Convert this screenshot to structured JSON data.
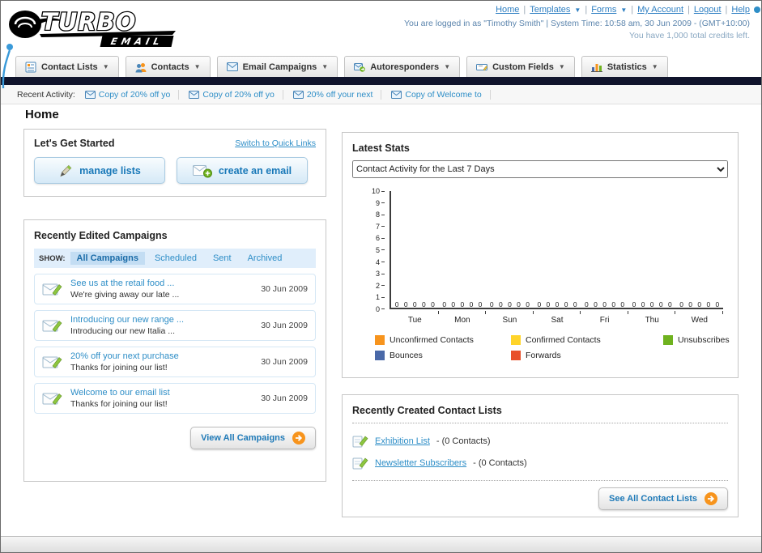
{
  "logo": {
    "brand": "TURBO",
    "sub": "EMAIL"
  },
  "header": {
    "links": [
      "Home",
      "Templates",
      "Forms",
      "My Account",
      "Logout",
      "Help"
    ],
    "login_text": "You are logged in as \"Timothy Smith\" | System Time: 10:58 am, 30 Jun 2009 - (GMT+10:00)",
    "credits_text": "You have 1,000 total credits left."
  },
  "nav": {
    "items": [
      {
        "label": "Contact Lists"
      },
      {
        "label": "Contacts"
      },
      {
        "label": "Email Campaigns"
      },
      {
        "label": "Autoresponders"
      },
      {
        "label": "Custom Fields"
      },
      {
        "label": "Statistics"
      }
    ]
  },
  "recent_activity": {
    "label": "Recent Activity:",
    "items": [
      {
        "label": "Copy of 20% off yo"
      },
      {
        "label": "Copy of 20% off yo"
      },
      {
        "label": "20% off your next"
      },
      {
        "label": "Copy of Welcome to"
      }
    ]
  },
  "page": {
    "title": "Home"
  },
  "get_started": {
    "title": "Let's Get Started",
    "switch_link": "Switch to Quick Links",
    "manage_button": "manage lists",
    "create_button": "create an email"
  },
  "campaigns": {
    "title": "Recently Edited Campaigns",
    "show_label": "SHOW:",
    "tabs": [
      {
        "label": "All Campaigns"
      },
      {
        "label": "Scheduled"
      },
      {
        "label": "Sent"
      },
      {
        "label": "Archived"
      }
    ],
    "items": [
      {
        "title": "See us at the retail food ...",
        "subtitle": "We're giving away our late ...",
        "date": "30 Jun 2009"
      },
      {
        "title": "Introducing our new range ...",
        "subtitle": "Introducing our new Italia ...",
        "date": "30 Jun 2009"
      },
      {
        "title": "20% off your next purchase",
        "subtitle": "Thanks for joining our list!",
        "date": "30 Jun 2009"
      },
      {
        "title": "Welcome to our email list",
        "subtitle": "Thanks for joining our list!",
        "date": "30 Jun 2009"
      }
    ],
    "view_all_label": "View All Campaigns"
  },
  "stats": {
    "title": "Latest Stats",
    "period_selected": "Contact Activity for the Last 7 Days"
  },
  "chart_data": {
    "type": "bar",
    "title": "Contact Activity for the Last 7 Days",
    "categories": [
      "Tue",
      "Mon",
      "Sun",
      "Sat",
      "Fri",
      "Thu",
      "Wed"
    ],
    "series": [
      {
        "name": "Unconfirmed Contacts",
        "color": "#f7941d",
        "values": [
          0,
          0,
          0,
          0,
          0,
          0,
          0
        ]
      },
      {
        "name": "Confirmed Contacts",
        "color": "#ffd42a",
        "values": [
          0,
          0,
          0,
          0,
          0,
          0,
          0
        ]
      },
      {
        "name": "Unsubscribes",
        "color": "#6fb21f",
        "values": [
          0,
          0,
          0,
          0,
          0,
          0,
          0
        ]
      },
      {
        "name": "Bounces",
        "color": "#4a69a8",
        "values": [
          0,
          0,
          0,
          0,
          0,
          0,
          0
        ]
      },
      {
        "name": "Forwards",
        "color": "#e8502a",
        "values": [
          0,
          0,
          0,
          0,
          0,
          0,
          0
        ]
      }
    ],
    "ylim": [
      0,
      10
    ],
    "yticks": [
      "10",
      "9",
      "8",
      "7",
      "6",
      "5",
      "4",
      "3",
      "2",
      "1",
      "0"
    ],
    "grid": false,
    "legend_position": "bottom",
    "zero_row_label": "0 0 0 0 0"
  },
  "contact_lists": {
    "title": "Recently Created Contact Lists",
    "items": [
      {
        "name": "Exhibition List",
        "count": "- (0 Contacts)"
      },
      {
        "name": "Newsletter Subscribers",
        "count": "- (0 Contacts)"
      }
    ],
    "see_all_label": "See All Contact Lists"
  }
}
